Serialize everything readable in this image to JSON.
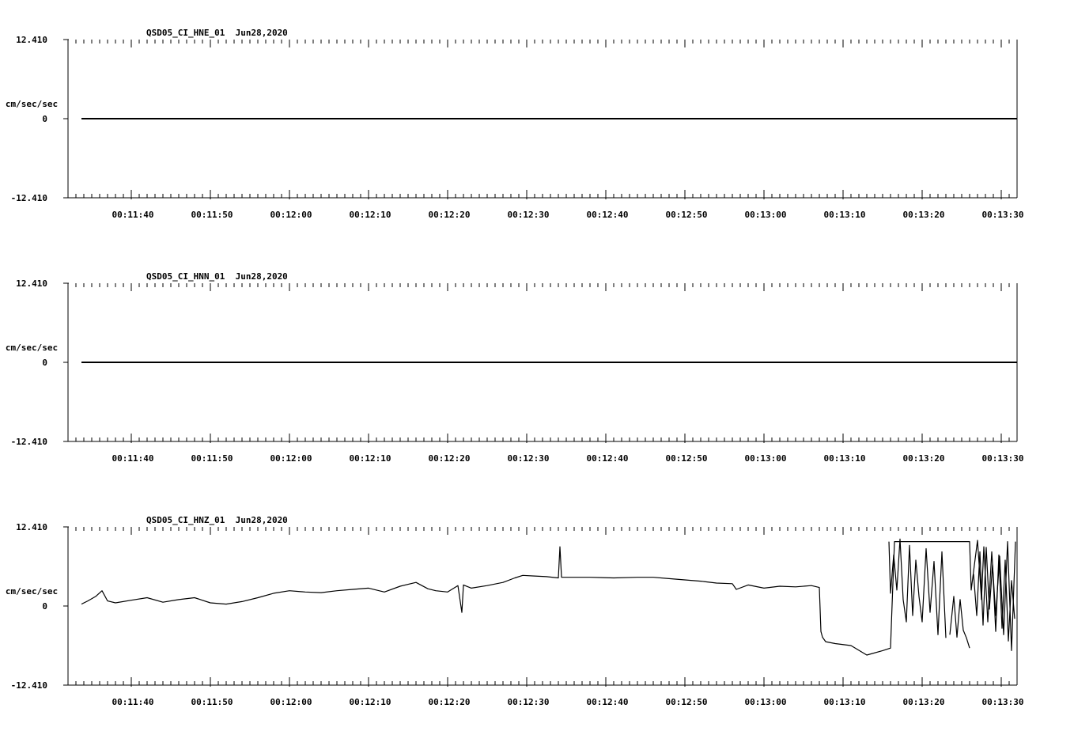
{
  "chart_data": [
    {
      "type": "line",
      "title": "QSD05_CI_HNE_01  Jun28,2020",
      "ylabel": "cm/sec/sec",
      "y_tick_labels": [
        "12.410",
        "0",
        "-12.410"
      ],
      "ylim": [
        -12.41,
        12.41
      ],
      "x_tick_labels": [
        "00:11:40",
        "00:11:50",
        "00:12:00",
        "00:12:10",
        "00:12:20",
        "00:12:30",
        "00:12:40",
        "00:12:50",
        "00:13:00",
        "00:13:10",
        "00:13:20",
        "00:13:30"
      ],
      "xlim_seconds": [
        692,
        812
      ],
      "series": [
        {
          "x": [
            693.7,
            812.0
          ],
          "y": [
            0.0,
            0.0
          ]
        }
      ]
    },
    {
      "type": "line",
      "title": "QSD05_CI_HNN_01  Jun28,2020",
      "ylabel": "cm/sec/sec",
      "y_tick_labels": [
        "12.410",
        "0",
        "-12.410"
      ],
      "ylim": [
        -12.41,
        12.41
      ],
      "x_tick_labels": [
        "00:11:40",
        "00:11:50",
        "00:12:00",
        "00:12:10",
        "00:12:20",
        "00:12:30",
        "00:12:40",
        "00:12:50",
        "00:13:00",
        "00:13:10",
        "00:13:20",
        "00:13:30"
      ],
      "xlim_seconds": [
        692,
        812
      ],
      "series": [
        {
          "x": [
            693.7,
            812.0
          ],
          "y": [
            0.0,
            0.0
          ]
        }
      ]
    },
    {
      "type": "line",
      "title": "QSD05_CI_HNZ_01  Jun28,2020",
      "ylabel": "cm/sec/sec",
      "y_tick_labels": [
        "12.410",
        "0",
        "-12.410"
      ],
      "ylim": [
        -12.41,
        12.41
      ],
      "x_tick_labels": [
        "00:11:40",
        "00:11:50",
        "00:12:00",
        "00:12:10",
        "00:12:20",
        "00:12:30",
        "00:12:40",
        "00:12:50",
        "00:13:00",
        "00:13:10",
        "00:13:20",
        "00:13:30"
      ],
      "xlim_seconds": [
        692,
        812
      ],
      "series": [
        {
          "x": [
            693.7,
            694.5,
            695.5,
            696.3,
            697.0,
            698.0,
            700.0,
            702.0,
            704.0,
            706.0,
            708.0,
            710.0,
            712.0,
            714.0,
            716.0,
            718.0,
            720.0,
            722.0,
            724.0,
            726.0,
            728.0,
            730.0,
            732.0,
            734.0,
            736.0,
            737.5,
            738.5,
            740.0,
            741.3,
            741.8,
            742.0,
            743.0,
            745.0,
            747.0,
            748.5,
            749.5,
            751.0,
            752.5,
            754.0,
            754.2,
            754.4,
            755.0,
            758.0,
            761.0,
            764.0,
            766.0,
            768.0,
            770.0,
            772.0,
            774.0,
            776.0,
            776.5,
            778.0,
            780.0,
            782.0,
            784.0,
            786.0,
            787.0,
            787.2,
            787.4,
            787.8,
            789.0,
            791.0,
            793.0,
            795.0,
            796.0,
            796.2,
            796.5,
            801.0,
            806.0,
            806.2,
            807.0,
            807.5,
            807.8,
            808.3,
            808.8,
            809.3,
            809.8,
            810.3,
            810.8,
            811.3,
            811.8
          ],
          "y": [
            0.3,
            0.8,
            1.5,
            2.4,
            0.8,
            0.5,
            0.9,
            1.3,
            0.6,
            1.0,
            1.3,
            0.5,
            0.3,
            0.7,
            1.3,
            2.0,
            2.4,
            2.2,
            2.1,
            2.4,
            2.6,
            2.8,
            2.2,
            3.1,
            3.7,
            2.7,
            2.4,
            2.2,
            3.2,
            -1.0,
            3.3,
            2.8,
            3.2,
            3.7,
            4.4,
            4.8,
            4.7,
            4.6,
            4.4,
            9.3,
            4.5,
            4.5,
            4.5,
            4.4,
            4.5,
            4.5,
            4.3,
            4.1,
            3.9,
            3.6,
            3.5,
            2.6,
            3.3,
            2.8,
            3.1,
            3.0,
            3.2,
            2.9,
            -4.0,
            -4.9,
            -5.6,
            -5.9,
            -6.2,
            -7.7,
            -7.0,
            -6.6,
            0.2,
            10.1,
            10.1,
            10.1,
            2.5,
            10.3,
            1.0,
            9.3,
            -2.5,
            8.5,
            -1.5,
            7.8,
            -4.5,
            10.1,
            -7.0,
            10.1
          ]
        },
        {
          "x": [
            806.5,
            806.9,
            807.3,
            807.7,
            808.1,
            808.5,
            808.9,
            809.3,
            809.7,
            810.1,
            810.5,
            810.9,
            811.3,
            811.7
          ],
          "y": [
            5.0,
            -1.5,
            8.5,
            -3.0,
            9.2,
            -0.5,
            6.5,
            -4.0,
            8.0,
            -3.5,
            7.2,
            -5.5,
            4.0,
            -2.0
          ]
        },
        {
          "x": [
            803.5,
            804.0,
            804.4,
            804.8,
            805.2,
            805.6,
            806.0
          ],
          "y": [
            -4.5,
            1.5,
            -4.9,
            1.0,
            -3.8,
            -5.0,
            -6.6
          ]
        },
        {
          "x": [
            795.8,
            796.0,
            796.4,
            796.8,
            797.2,
            797.6,
            798.0,
            798.4,
            798.8,
            799.2,
            799.6,
            800.0,
            800.5,
            801.0,
            801.5,
            802.0,
            802.5,
            803.0
          ],
          "y": [
            10.1,
            2.0,
            8.0,
            2.5,
            10.5,
            1.0,
            -2.5,
            9.5,
            -1.5,
            7.2,
            1.5,
            -2.5,
            9.0,
            -1.0,
            7.0,
            -4.5,
            8.5,
            -5.0
          ]
        }
      ]
    }
  ]
}
